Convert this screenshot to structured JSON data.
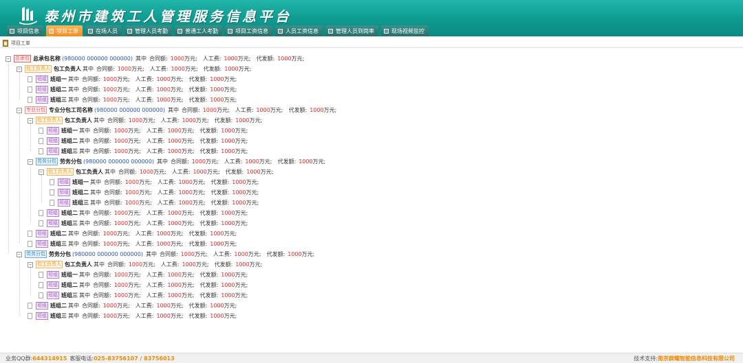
{
  "header": {
    "title": "泰州市建筑工人管理服务信息平台",
    "logo_icon": "building-logo-icon"
  },
  "nav": {
    "tabs": [
      {
        "label": "项目信息",
        "active": false
      },
      {
        "label": "项目工单",
        "active": true
      },
      {
        "label": "在场人员",
        "active": false
      },
      {
        "label": "管理人员考勤",
        "active": false
      },
      {
        "label": "普通工人考勤",
        "active": false
      },
      {
        "label": "项目工资信息",
        "active": false
      },
      {
        "label": "人员工资信息",
        "active": false
      },
      {
        "label": "管理人员到岗率",
        "active": false
      },
      {
        "label": "现场视频监控",
        "active": false
      }
    ]
  },
  "breadcrumb": {
    "label": "项目工单",
    "icon": "document-icon"
  },
  "labels": {
    "within": "其中",
    "contract": "合同额:",
    "labor": "人工费:",
    "proxy": "代发额:",
    "unit": "万元;"
  },
  "tree": [
    {
      "level": 0,
      "toggle": "−",
      "tag": "总承包",
      "tagType": "main",
      "name": "总承包名称",
      "code": "(980000 000000 000000)",
      "contract": "1000",
      "labor": "1000",
      "proxy": "1000"
    },
    {
      "level": 1,
      "toggle": "−",
      "tag": "包工负责人",
      "tagType": "lead",
      "name": "包工负责人",
      "contract": "1000",
      "labor": "1000",
      "proxy": "1000"
    },
    {
      "level": 2,
      "leaf": true,
      "tag": "班组",
      "tagType": "team",
      "name": "班组一",
      "contract": "1000",
      "labor": "1000",
      "proxy": "1000"
    },
    {
      "level": 2,
      "leaf": true,
      "tag": "班组",
      "tagType": "team",
      "name": "班组二",
      "contract": "1000",
      "labor": "1000",
      "proxy": "1000"
    },
    {
      "level": 2,
      "leaf": true,
      "tag": "班组",
      "tagType": "team",
      "name": "班组三",
      "contract": "1000",
      "labor": "1000",
      "proxy": "1000"
    },
    {
      "level": 1,
      "toggle": "−",
      "tag": "专业分包",
      "tagType": "spec",
      "name": "专业分包工司名称",
      "code": "(980000 000000 000000)",
      "contract": "1000",
      "labor": "1000",
      "proxy": "1000"
    },
    {
      "level": 2,
      "toggle": "−",
      "tag": "包工负责人",
      "tagType": "lead",
      "name": "包工负责人",
      "contract": "1000",
      "labor": "1000",
      "proxy": "1000"
    },
    {
      "level": 3,
      "leaf": true,
      "tag": "班组",
      "tagType": "team",
      "name": "班组一",
      "contract": "1000",
      "labor": "1000",
      "proxy": "1000"
    },
    {
      "level": 3,
      "leaf": true,
      "tag": "班组",
      "tagType": "team",
      "name": "班组二",
      "contract": "1000",
      "labor": "1000",
      "proxy": "1000"
    },
    {
      "level": 3,
      "leaf": true,
      "tag": "班组",
      "tagType": "team",
      "name": "班组三",
      "contract": "1000",
      "labor": "1000",
      "proxy": "1000"
    },
    {
      "level": 2,
      "toggle": "−",
      "tag": "劳务分包",
      "tagType": "labor",
      "name": "劳务分包",
      "code": "(980000 000000 000000)",
      "contract": "1000",
      "labor": "1000",
      "proxy": "1000"
    },
    {
      "level": 3,
      "toggle": "−",
      "tag": "包工负责人",
      "tagType": "lead",
      "name": "包工负责人",
      "contract": "1000",
      "labor": "1000",
      "proxy": "1000"
    },
    {
      "level": 4,
      "leaf": true,
      "tag": "班组",
      "tagType": "team",
      "name": "班组一",
      "contract": "1000",
      "labor": "1000",
      "proxy": "1000"
    },
    {
      "level": 4,
      "leaf": true,
      "tag": "班组",
      "tagType": "team",
      "name": "班组二",
      "contract": "1000",
      "labor": "1000",
      "proxy": "1000"
    },
    {
      "level": 4,
      "leaf": true,
      "tag": "班组",
      "tagType": "team",
      "name": "班组三",
      "contract": "1000",
      "labor": "1000",
      "proxy": "1000"
    },
    {
      "level": 3,
      "leaf": true,
      "tag": "班组",
      "tagType": "team",
      "name": "班组二",
      "contract": "1000",
      "labor": "1000",
      "proxy": "1000"
    },
    {
      "level": 3,
      "leaf": true,
      "tag": "班组",
      "tagType": "team",
      "name": "班组三",
      "contract": "1000",
      "labor": "1000",
      "proxy": "1000"
    },
    {
      "level": 2,
      "leaf": true,
      "tag": "班组",
      "tagType": "team",
      "name": "班组二",
      "contract": "1000",
      "labor": "1000",
      "proxy": "1000"
    },
    {
      "level": 2,
      "leaf": true,
      "tag": "班组",
      "tagType": "team",
      "name": "班组三",
      "contract": "1000",
      "labor": "1000",
      "proxy": "1000"
    },
    {
      "level": 1,
      "toggle": "−",
      "tag": "劳务分包",
      "tagType": "labor",
      "name": "劳务分包",
      "code": "(980000 000000 000000)",
      "contract": "1000",
      "labor": "1000",
      "proxy": "1000"
    },
    {
      "level": 2,
      "toggle": "−",
      "tag": "包工负责人",
      "tagType": "lead",
      "name": "包工负责人",
      "contract": "1000",
      "labor": "1000",
      "proxy": "1000"
    },
    {
      "level": 3,
      "leaf": true,
      "tag": "班组",
      "tagType": "team",
      "name": "班组一",
      "contract": "1000",
      "labor": "1000",
      "proxy": "1000"
    },
    {
      "level": 3,
      "leaf": true,
      "tag": "班组",
      "tagType": "team",
      "name": "班组二",
      "contract": "1000",
      "labor": "1000",
      "proxy": "1000"
    },
    {
      "level": 3,
      "leaf": true,
      "tag": "班组",
      "tagType": "team",
      "name": "班组三",
      "contract": "1000",
      "labor": "1000",
      "proxy": "1000"
    },
    {
      "level": 2,
      "leaf": true,
      "tag": "班组",
      "tagType": "team",
      "name": "班组二",
      "contract": "1000",
      "labor": "1000",
      "proxy": "1000"
    },
    {
      "level": 2,
      "leaf": true,
      "tag": "班组",
      "tagType": "team",
      "name": "班组三",
      "contract": "1000",
      "labor": "1000",
      "proxy": "1000"
    }
  ],
  "footer": {
    "qq_label": "业务QQ群:",
    "qq_value": "644314915",
    "phone_label": "客服电话:",
    "phone_value": "025-83756107 / 83756013",
    "support_label": "技术支持:",
    "support_value": "南京群耀智能信息科技有限公司"
  },
  "colors": {
    "header": "#0e9a90",
    "active_tab": "#f58d1e",
    "value": "#e22222",
    "code": "#2a55c8"
  }
}
